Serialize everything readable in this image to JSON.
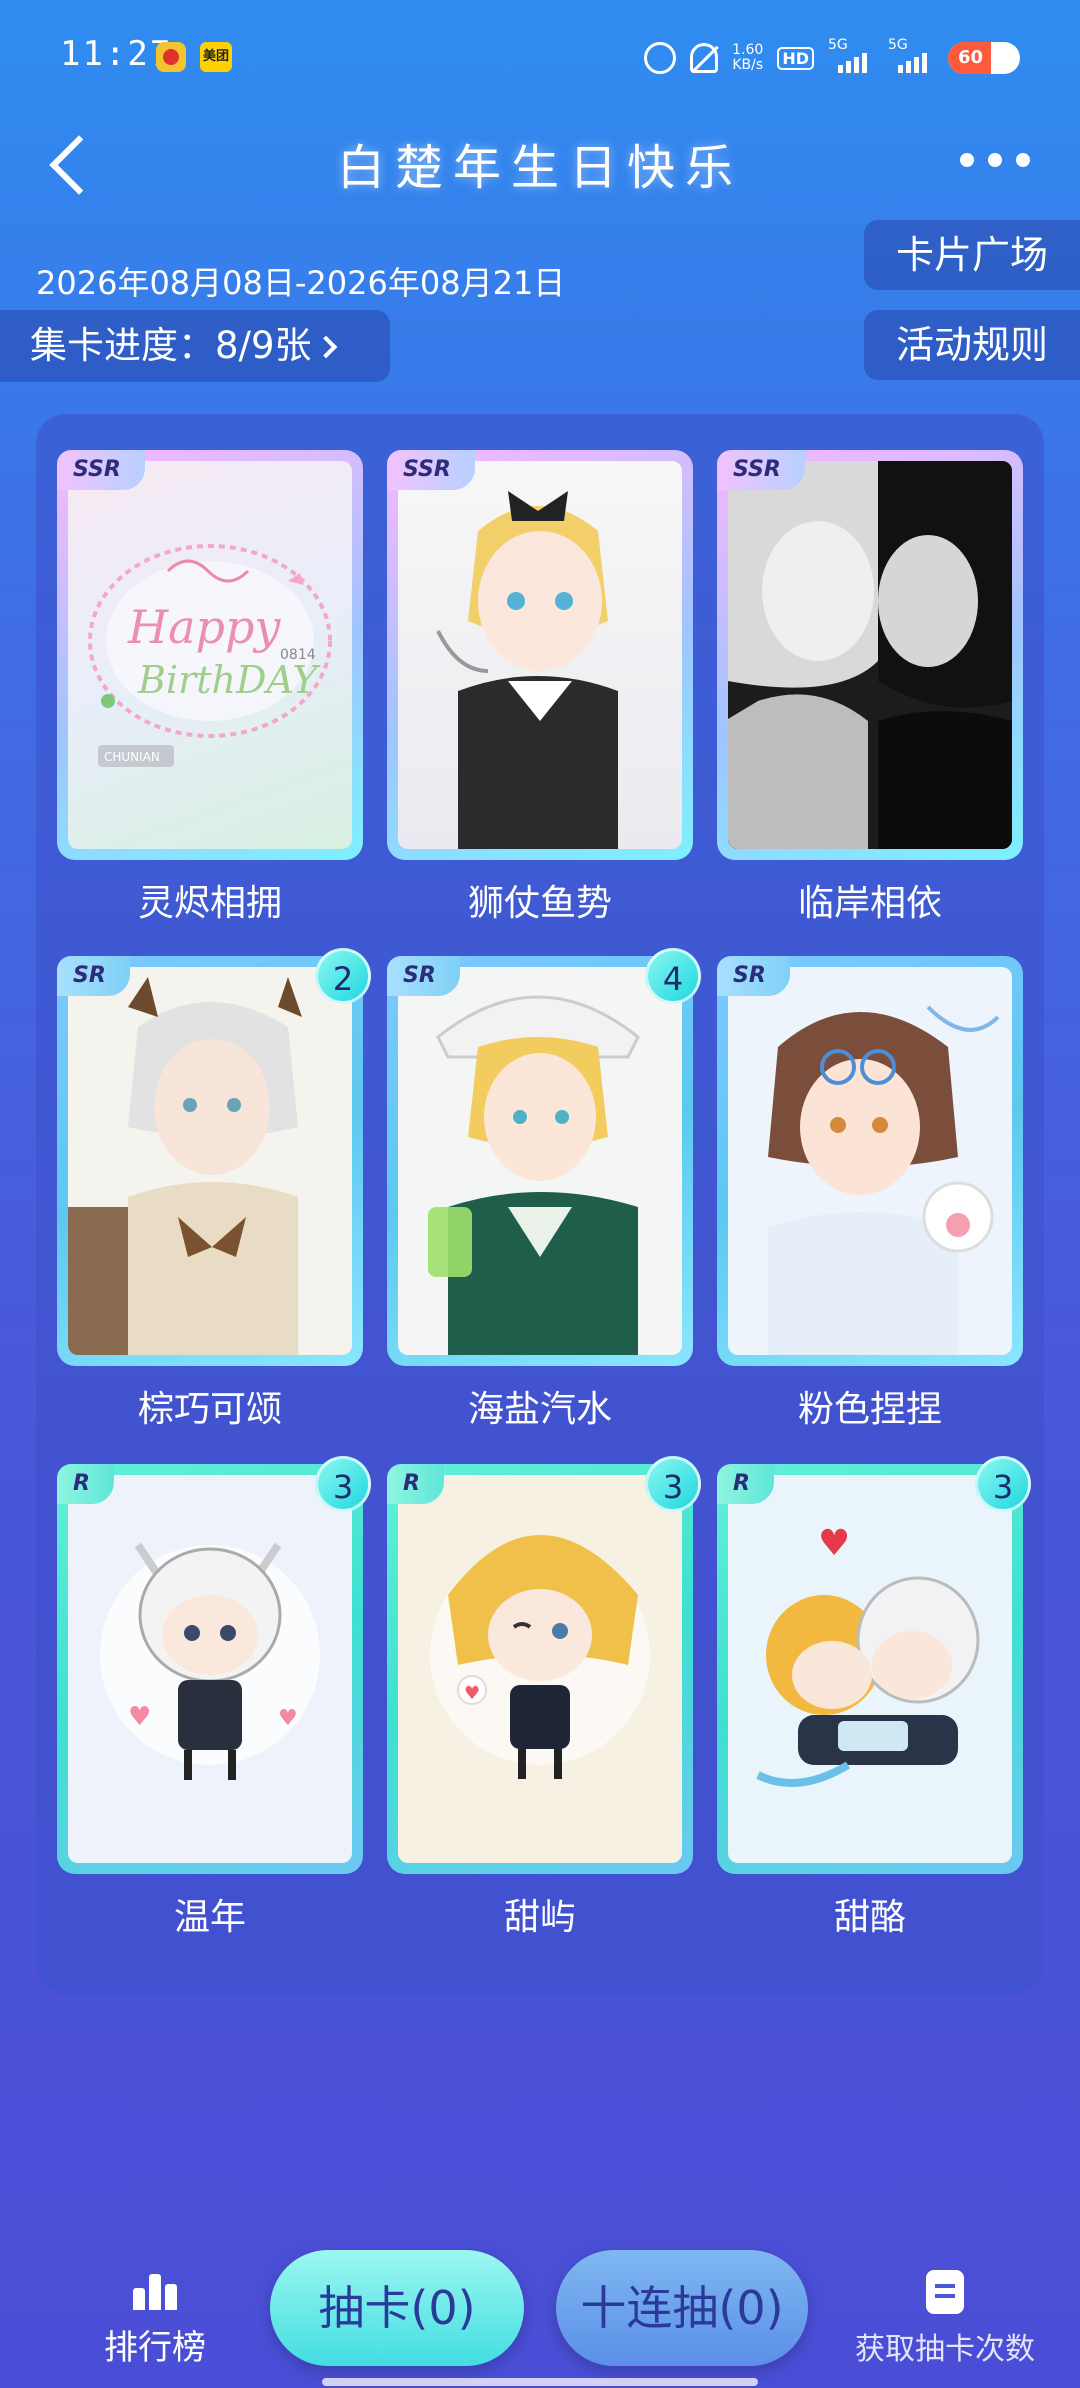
{
  "status_bar": {
    "time": "11:27",
    "net_speed_top": "1.60",
    "net_speed_unit": "KB/s",
    "hd_label": "HD",
    "signal_1": "5G",
    "signal_2": "5G",
    "battery": "60",
    "battery_level_percent": 60,
    "meituan_label": "美团"
  },
  "header": {
    "title": "白楚年生日快乐"
  },
  "event": {
    "date_range": "2026年08月08日-2026年08月21日",
    "progress_label": "集卡进度：8/9张",
    "card_square_label": "卡片广场",
    "rules_label": "活动规则"
  },
  "cards": [
    {
      "rarity": "SSR",
      "name": "灵烬相拥",
      "count": ""
    },
    {
      "rarity": "SSR",
      "name": "狮仗鱼势",
      "count": ""
    },
    {
      "rarity": "SSR",
      "name": "临岸相依",
      "count": ""
    },
    {
      "rarity": "SR",
      "name": "棕巧可颂",
      "count": "2"
    },
    {
      "rarity": "SR",
      "name": "海盐汽水",
      "count": "4"
    },
    {
      "rarity": "SR",
      "name": "粉色捏捏",
      "count": ""
    },
    {
      "rarity": "R",
      "name": "温年",
      "count": "3"
    },
    {
      "rarity": "R",
      "name": "甜屿",
      "count": "3"
    },
    {
      "rarity": "R",
      "name": "甜酪",
      "count": "3"
    }
  ],
  "card_art_texts": {
    "happy": "Happy",
    "birthday": "BirthDAY",
    "number": "0814",
    "chunian": "CHUNIAN"
  },
  "bottom": {
    "rank_label": "排行榜",
    "draw_label": "抽卡(0)",
    "ten_draw_label": "十连抽(0)",
    "record_label": "获取抽卡次数"
  },
  "colors": {
    "ssr_frame": "#f0a0e8",
    "sr_frame": "#5cc8f0",
    "r_frame": "#3de0d0",
    "button_cyan": "#43dde2"
  }
}
